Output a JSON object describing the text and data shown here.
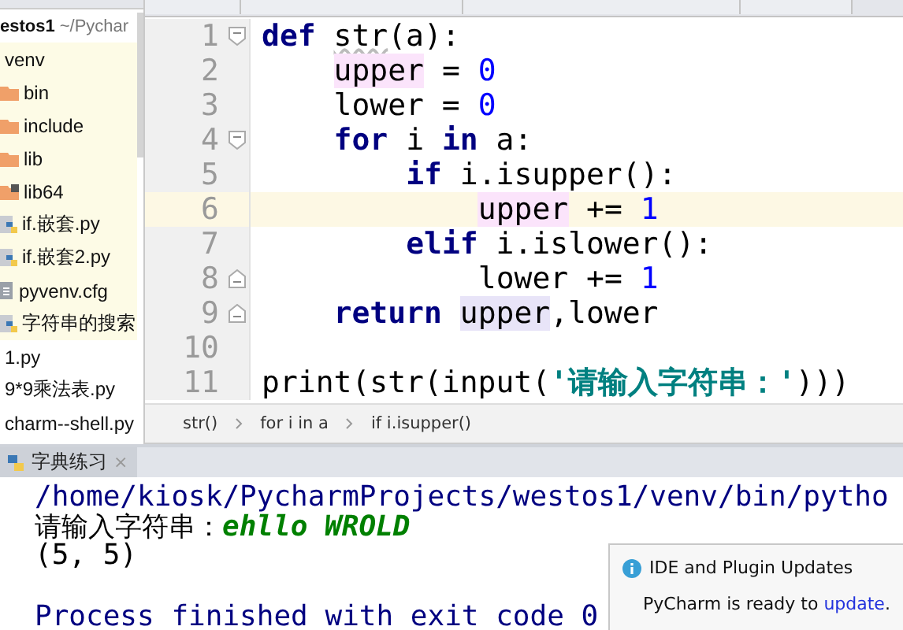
{
  "project_tree": {
    "name": "estos1",
    "path": "~/Pychar",
    "children": [
      {
        "label": "venv",
        "excluded": true,
        "children": [
          {
            "label": "bin",
            "kind": "folder",
            "excluded": true
          },
          {
            "label": "include",
            "kind": "folder",
            "excluded": true
          },
          {
            "label": "lib",
            "kind": "folder",
            "excluded": true
          },
          {
            "label": "lib64",
            "kind": "folder-link",
            "excluded": true
          },
          {
            "label": "if.嵌套.py",
            "kind": "python",
            "excluded": true
          },
          {
            "label": "if.嵌套2.py",
            "kind": "python",
            "excluded": true
          },
          {
            "label": "pyvenv.cfg",
            "kind": "config",
            "excluded": true
          },
          {
            "label": "字符串的搜索",
            "kind": "python",
            "excluded": true
          }
        ]
      },
      {
        "label": "1.py",
        "excluded": false
      },
      {
        "label": "9*9乘法表.py",
        "excluded": false
      },
      {
        "label": "charm--shell.py",
        "excluded": false
      }
    ]
  },
  "editor": {
    "lines": [
      {
        "number": "1",
        "current": false,
        "fold_start": true,
        "tokens": [
          {
            "kind": "kw",
            "text": "def "
          },
          {
            "kind": "warn",
            "text": "str"
          },
          {
            "kind": "plain",
            "text": "(a):"
          }
        ],
        "children": [
          {
            "number": "2",
            "current": false,
            "tokens": [
              {
                "kind": "write",
                "text": "upper"
              },
              {
                "kind": "plain",
                "text": " = "
              },
              {
                "kind": "num",
                "text": "0"
              }
            ]
          },
          {
            "number": "3",
            "current": false,
            "tokens": [
              {
                "kind": "plain",
                "text": "lower = "
              },
              {
                "kind": "num",
                "text": "0"
              }
            ]
          },
          {
            "number": "4",
            "current": false,
            "fold_start": true,
            "tokens": [
              {
                "kind": "kw",
                "text": "for"
              },
              {
                "kind": "plain",
                "text": " i "
              },
              {
                "kind": "kw",
                "text": "in"
              },
              {
                "kind": "plain",
                "text": " a:"
              }
            ],
            "children": [
              {
                "number": "5",
                "current": false,
                "tokens": [
                  {
                    "kind": "kw",
                    "text": "if"
                  },
                  {
                    "kind": "plain",
                    "text": " i.isupper():"
                  }
                ],
                "children": [
                  {
                    "number": "6",
                    "current": true,
                    "tokens": [
                      {
                        "kind": "write",
                        "text": "upper"
                      },
                      {
                        "kind": "plain",
                        "text": " += "
                      },
                      {
                        "kind": "num",
                        "text": "1"
                      }
                    ]
                  }
                ]
              },
              {
                "number": "7",
                "current": false,
                "tokens": [
                  {
                    "kind": "kw",
                    "text": "elif"
                  },
                  {
                    "kind": "plain",
                    "text": " i.islower():"
                  }
                ],
                "children": [
                  {
                    "number": "8",
                    "current": false,
                    "fold_end": true,
                    "tokens": [
                      {
                        "kind": "plain",
                        "text": "lower += "
                      },
                      {
                        "kind": "num",
                        "text": "1"
                      }
                    ]
                  }
                ]
              }
            ]
          },
          {
            "number": "9",
            "current": false,
            "fold_end": true,
            "tokens": [
              {
                "kind": "kw",
                "text": "return "
              },
              {
                "kind": "read",
                "text": "upper"
              },
              {
                "kind": "plain",
                "text": ",lower"
              }
            ]
          }
        ]
      },
      {
        "number": "10",
        "current": false
      },
      {
        "number": "11",
        "current": false,
        "tokens": [
          {
            "kind": "plain",
            "text": "print(str(input("
          },
          {
            "kind": "str",
            "text": "'请输入字符串：'"
          },
          {
            "kind": "plain",
            "text": ")))"
          }
        ]
      }
    ],
    "breadcrumbs": [
      "str()",
      "for i in a",
      "if i.isupper()"
    ]
  },
  "run_panel": {
    "tabs": [
      {
        "label": "字典练习",
        "close": "×",
        "selected": true
      }
    ],
    "console": [
      {
        "kind": "path",
        "text": "/home/kiosk/PycharmProjects/westos1/venv/bin/pytho"
      },
      {
        "kind": "input",
        "text": "请输入字符串：",
        "typed": "ehllo WROLD"
      },
      {
        "kind": "output",
        "text": "(5, 5)"
      },
      {
        "kind": "blank"
      },
      {
        "kind": "path",
        "text": "Process finished with exit code 0"
      }
    ]
  },
  "notification": {
    "title": "IDE and Plugin Updates",
    "body": "PyCharm is ready to ",
    "link": "update",
    "end": "."
  }
}
